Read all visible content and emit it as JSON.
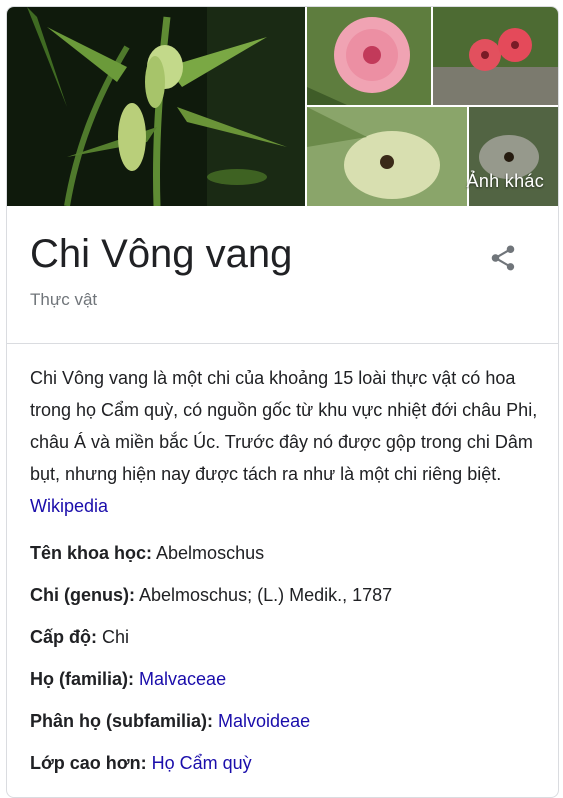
{
  "gallery": {
    "more_label": "Ảnh khác"
  },
  "header": {
    "title": "Chi Vông vang",
    "subtitle": "Thực vật"
  },
  "description": {
    "text": "Chi Vông vang là một chi của khoảng 15 loài thực vật có hoa trong họ Cẩm quỳ, có nguồn gốc từ khu vực nhiệt đới châu Phi, châu Á và miền bắc Úc. Trước đây nó được gộp trong chi Dâm bụt, nhưng hiện nay được tách ra như là một chi riêng biệt.",
    "source_link": "Wikipedia"
  },
  "facts": [
    {
      "label": "Tên khoa học:",
      "value": "Abelmoschus",
      "is_link": false
    },
    {
      "label": "Chi (genus):",
      "value": "Abelmoschus; (L.) Medik., 1787",
      "is_link": false
    },
    {
      "label": "Cấp độ:",
      "value": "Chi",
      "is_link": false
    },
    {
      "label": "Họ (familia):",
      "value": "Malvaceae",
      "is_link": true
    },
    {
      "label": "Phân họ (subfamilia):",
      "value": "Malvoideae",
      "is_link": true
    },
    {
      "label": "Lớp cao hơn:",
      "value": "Họ Cẩm quỳ",
      "is_link": true
    }
  ],
  "colors": {
    "link": "#1a0dab",
    "muted": "#70757a",
    "text": "#202124"
  },
  "icons": {
    "share": "share-icon"
  }
}
